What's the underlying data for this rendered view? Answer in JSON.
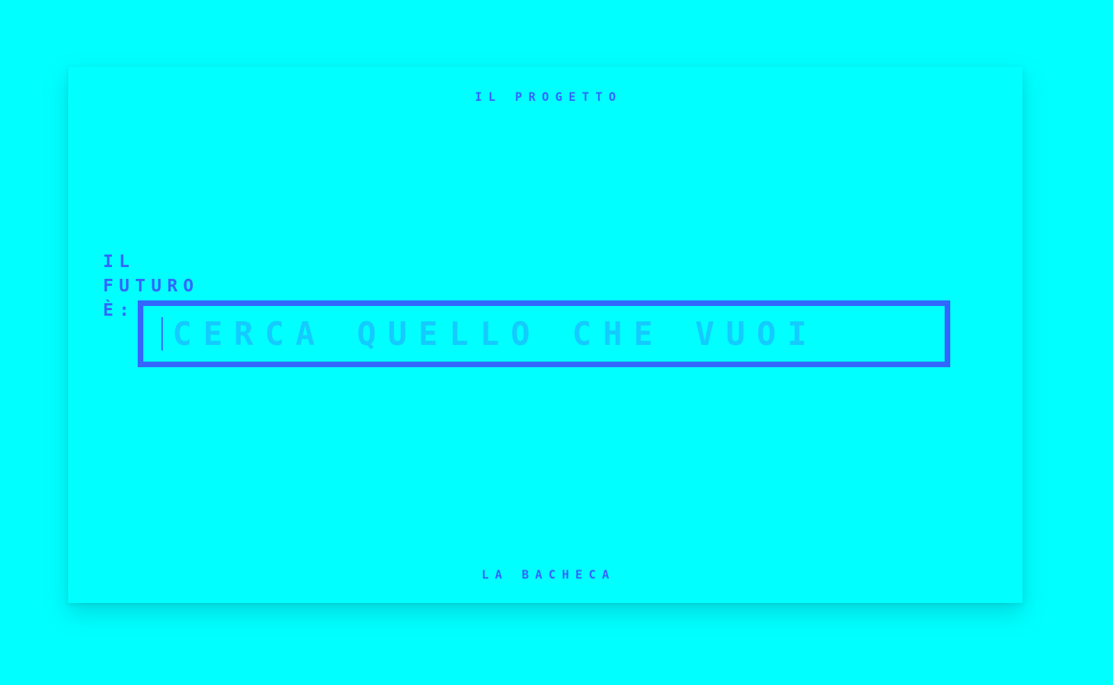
{
  "nav": {
    "top_link": "IL PROGETTO",
    "bottom_link": "LA BACHECA"
  },
  "headline": {
    "line1": "IL",
    "line2": "FUTURO",
    "line3": "È:"
  },
  "search": {
    "value": "",
    "placeholder": "CERCA QUELLO CHE VUOI"
  },
  "colors": {
    "background": "#00FFFF",
    "accent": "#3366FF",
    "placeholder": "#17C6FF"
  }
}
